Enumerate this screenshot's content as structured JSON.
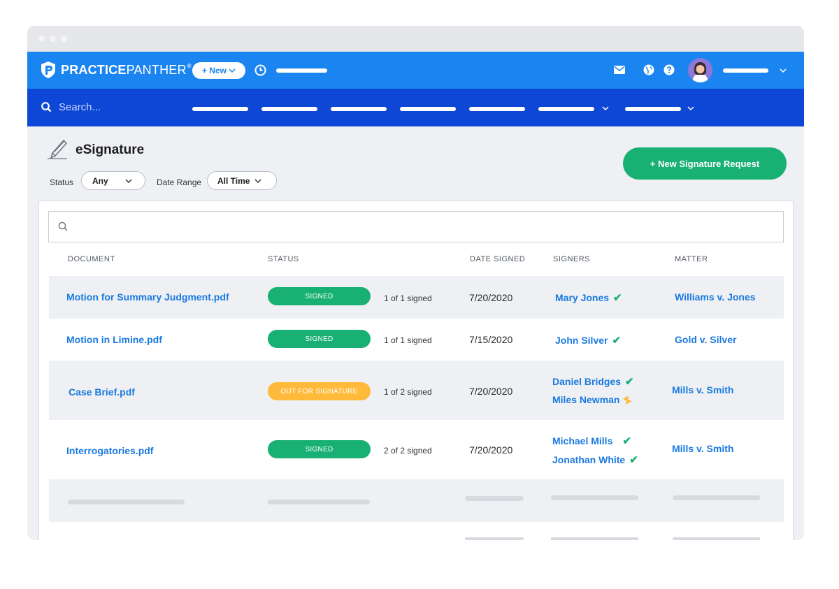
{
  "header": {
    "brand_bold": "PRACTICE",
    "brand_light": "PANTHER",
    "brand_reg": "®",
    "new_button": "+ New",
    "icons": [
      "clock-icon",
      "mail-icon",
      "globe-icon",
      "help-icon"
    ]
  },
  "nav": {
    "search_placeholder": "Search..."
  },
  "page": {
    "title": "eSignature",
    "status_label": "Status",
    "status_value": "Any",
    "date_range_label": "Date Range",
    "date_range_value": "All Time",
    "new_request_button": "+ New Signature Request"
  },
  "table": {
    "columns": [
      "DOCUMENT",
      "STATUS",
      "DATE SIGNED",
      "SIGNERS",
      "MATTER"
    ],
    "rows": [
      {
        "document": "Motion for Summary Judgment.pdf",
        "status": "SIGNED",
        "count": "1 of 1 signed",
        "date": "7/20/2020",
        "signers": [
          {
            "name": "Mary Jones",
            "state": "signed"
          }
        ],
        "matter": "Williams v. Jones"
      },
      {
        "document": "Motion in Limine.pdf",
        "status": "SIGNED",
        "count": "1 of 1 signed",
        "date": "7/15/2020",
        "signers": [
          {
            "name": "John Silver",
            "state": "signed"
          }
        ],
        "matter": "Gold v. Silver"
      },
      {
        "document": "Case Brief.pdf",
        "status": "OUT FOR SIGNATURE",
        "count": "1 of 2 signed",
        "date": "7/20/2020",
        "signers": [
          {
            "name": "Daniel Bridges",
            "state": "signed"
          },
          {
            "name": "Miles Newman",
            "state": "pending"
          }
        ],
        "matter": "Mills v. Smith"
      },
      {
        "document": "Interrogatories.pdf",
        "status": "SIGNED",
        "count": "2 of 2 signed",
        "date": "7/20/2020",
        "signers": [
          {
            "name": "Michael Mills",
            "state": "signed"
          },
          {
            "name": "Jonathan White",
            "state": "signed"
          }
        ],
        "matter": "Mills v. Smith"
      }
    ]
  },
  "colors": {
    "topbar": "#1a85f0",
    "navbar": "#0e47d6",
    "signed": "#19b074",
    "pending": "#ffba3b",
    "link": "#1a7ae0"
  }
}
